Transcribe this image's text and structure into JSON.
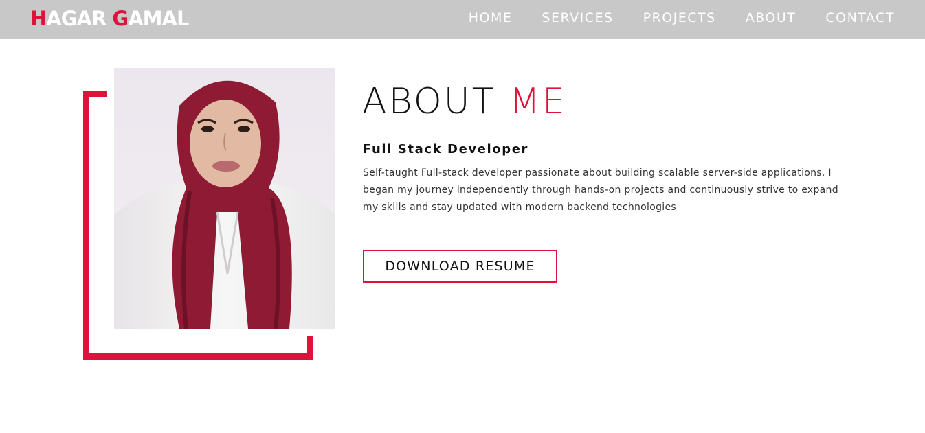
{
  "logo": {
    "first_initial": "H",
    "first_rest": "AGAR ",
    "last_initial": "G",
    "last_rest": "AMAL"
  },
  "nav": {
    "items": [
      {
        "label": "HOME"
      },
      {
        "label": "SERVICES"
      },
      {
        "label": "PROJECTS"
      },
      {
        "label": "ABOUT"
      },
      {
        "label": "CONTACT"
      }
    ]
  },
  "about": {
    "title_main": "ABOUT",
    "title_accent": "ME",
    "subtitle": "Full Stack Developer",
    "bio": "Self-taught Full-stack developer passionate about building scalable server-side applications. I began my journey independently through hands-on projects and continuously strive to expand my skills and stay updated with modern backend technologies",
    "resume_label": "DOWNLOAD RESUME"
  },
  "colors": {
    "accent": "#dc143c",
    "navbar_bg": "#c8c8c8",
    "text": "#111111"
  }
}
